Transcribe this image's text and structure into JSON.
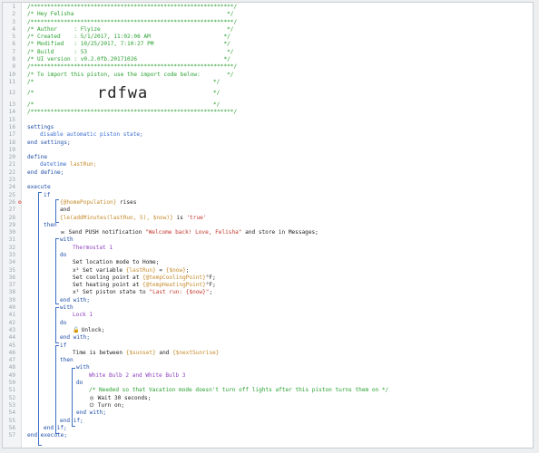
{
  "line_numbers": [
    "1",
    "2",
    "3",
    "4",
    "5",
    "6",
    "7",
    "8",
    "9",
    "10",
    "11",
    "12",
    "13",
    "14",
    "15",
    "16",
    "17",
    "18",
    "19",
    "20",
    "21",
    "22",
    "23",
    "24",
    "25",
    "26",
    "27",
    "28",
    "29",
    "30",
    "31",
    "32",
    "33",
    "34",
    "35",
    "36",
    "37",
    "38",
    "39",
    "40",
    "41",
    "42",
    "43",
    "44",
    "45",
    "46",
    "47",
    "48",
    "49",
    "50",
    "51",
    "52",
    "53",
    "54",
    "55",
    "56",
    "57"
  ],
  "header": {
    "stars": "/*************************************************************/",
    "title": "/* Hey Felisha                                              */",
    "author": "/* Author     : Flyize                                      */",
    "created": "/* Created    : 5/1/2017, 11:02:06 AM                      */",
    "modified": "/* Modified   : 10/25/2017, 7:10:27 PM                     */",
    "build": "/* Build      : 53                                          */",
    "ui_version": "/* UI version : v0.2.0fb.20171026                          */",
    "import_note": "/* To import this piston, use the import code below:        */",
    "blank_left": "/*",
    "blank_right": "*/",
    "import_code": "rdfwa"
  },
  "code": {
    "settings": "settings",
    "disable_auto": "disable automatic piston state;",
    "end_settings": "end settings;",
    "define": "define",
    "datetime": "datetime",
    "lastrun": "lastRun;",
    "end_define": "end define;",
    "execute": "execute",
    "if": "if",
    "home_population": "{@homePopulation}",
    "rises": "rises",
    "and": "and",
    "le_expr": "{le(addMinutes(lastRun, 5), $now)}",
    "is": "is",
    "true_str": "'true'",
    "then": "then",
    "send_push": "Send PUSH notification",
    "welcome_str": "\"Welcome back! Love, Felisha\"",
    "store_messages": "and store in Messages;",
    "with": "with",
    "thermostat": "Thermostat 1",
    "do": "do",
    "set_location": "Set location mode to",
    "home": "Home;",
    "x2": "x²",
    "set_variable": "Set variable",
    "lastrun_paren": "{lastRun}",
    "eq": "=",
    "now_var": "{$now}",
    "semi": ";",
    "set_cooling": "Set cooling point at",
    "temp_cooling": "{@tempCoolingPoint}",
    "set_heating": "Set heating point at",
    "temp_heating": "{@tempHeatingPoint}",
    "degf": "°F;",
    "set_piston_state": "Set piston state to",
    "last_run_str": "\"Last run: {$now}\"",
    "end_with": "end with;",
    "lock": "Lock 1",
    "unlock": "Unlock;",
    "time": "Time",
    "is_between": "is between",
    "sunset": "{$sunset}",
    "next_sunrise": "{$nextSunrise}",
    "bulbs": "White Bulb 2 and White Bulb 3",
    "vacation_comment": "/* Needed so that Vacation mode doesn't turn off lights after this piston turns them on */",
    "wait": "Wait 30 seconds;",
    "turn_on": "Turn on;",
    "end_if": "end if;",
    "end_execute": "end execute;"
  },
  "icons": [
    "breakpoint-icon",
    "message-icon",
    "variable-icon",
    "lock-icon",
    "clock-icon",
    "power-icon"
  ],
  "colors": {
    "comment": "#29a02f",
    "keyword": "#1f4ea8",
    "string": "#c0372b",
    "variable": "#c58a2a",
    "device": "#8e3fbf"
  }
}
